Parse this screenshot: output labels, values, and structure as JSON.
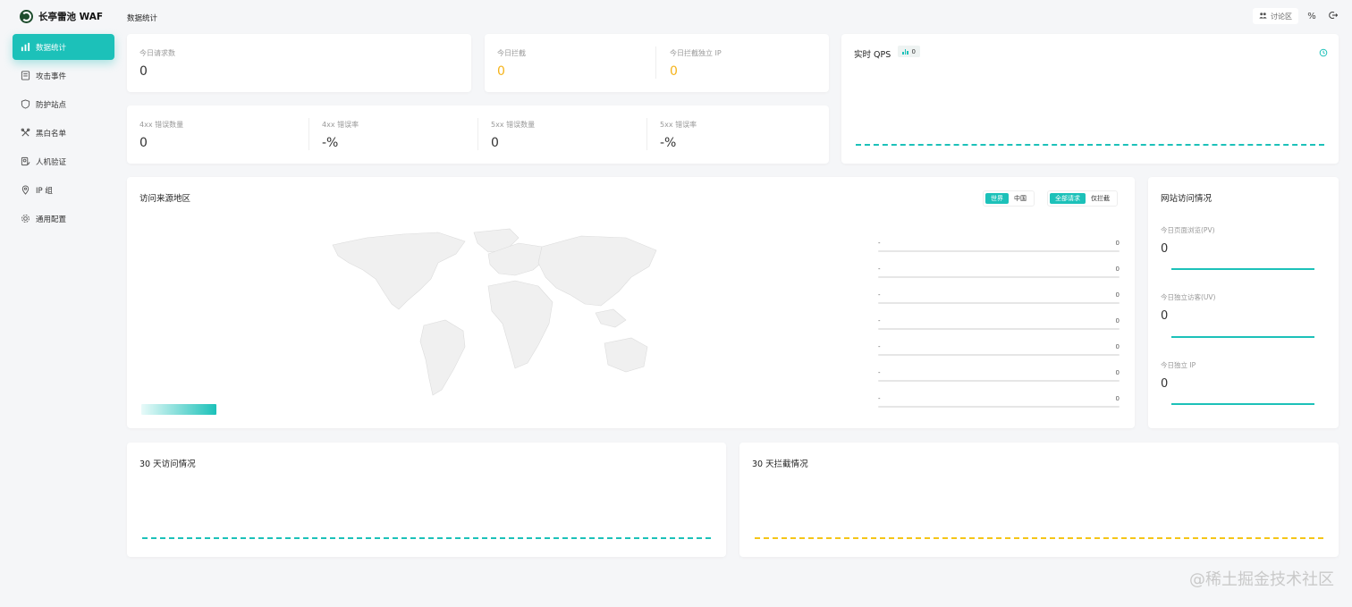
{
  "app": {
    "title": "长亭雷池 WAF"
  },
  "sidebar": {
    "items": [
      {
        "label": "数据统计",
        "icon": "bar-chart-icon",
        "active": true
      },
      {
        "label": "攻击事件",
        "icon": "document-icon",
        "active": false
      },
      {
        "label": "防护站点",
        "icon": "shield-icon",
        "active": false
      },
      {
        "label": "黑白名单",
        "icon": "tools-icon",
        "active": false
      },
      {
        "label": "人机验证",
        "icon": "user-check-icon",
        "active": false
      },
      {
        "label": "IP 组",
        "icon": "location-icon",
        "active": false
      },
      {
        "label": "通用配置",
        "icon": "gear-icon",
        "active": false
      }
    ]
  },
  "header": {
    "page_title": "数据统计",
    "forum_label": "讨论区",
    "percent_icon": "percent-icon",
    "logout_icon": "logout-icon"
  },
  "stats": {
    "today_requests": {
      "label": "今日请求数",
      "value": "0"
    },
    "today_blocked": {
      "label": "今日拦截",
      "value": "0"
    },
    "today_blocked_ip": {
      "label": "今日拦截独立 IP",
      "value": "0"
    },
    "err_4xx_count": {
      "label": "4xx 错误数量",
      "value": "0"
    },
    "err_4xx_rate": {
      "label": "4xx 错误率",
      "value": "-%"
    },
    "err_5xx_count": {
      "label": "5xx 错误数量",
      "value": "0"
    },
    "err_5xx_rate": {
      "label": "5xx 错误率",
      "value": "-%"
    }
  },
  "qps": {
    "title": "实时 QPS",
    "value": "0"
  },
  "geo": {
    "title": "访问来源地区",
    "scope_tabs": [
      {
        "label": "世界",
        "active": true
      },
      {
        "label": "中国",
        "active": false
      }
    ],
    "filter_tabs": [
      {
        "label": "全部请求",
        "active": true
      },
      {
        "label": "仅拦截",
        "active": false
      }
    ],
    "ranking": [
      {
        "name": "-",
        "value": "0"
      },
      {
        "name": "-",
        "value": "0"
      },
      {
        "name": "-",
        "value": "0"
      },
      {
        "name": "-",
        "value": "0"
      },
      {
        "name": "-",
        "value": "0"
      },
      {
        "name": "-",
        "value": "0"
      },
      {
        "name": "-",
        "value": "0"
      }
    ]
  },
  "site_access": {
    "title": "网站访问情况",
    "pv": {
      "label": "今日页面浏览(PV)",
      "value": "0"
    },
    "uv": {
      "label": "今日独立访客(UV)",
      "value": "0"
    },
    "ip": {
      "label": "今日独立 IP",
      "value": "0"
    }
  },
  "trend": {
    "access_title": "30 天访问情况",
    "blocked_title": "30 天拦截情况"
  },
  "colors": {
    "accent": "#1cc1b9",
    "warn": "#f5b31a",
    "block_line": "#f5c518"
  },
  "watermark": "@稀土掘金技术社区"
}
